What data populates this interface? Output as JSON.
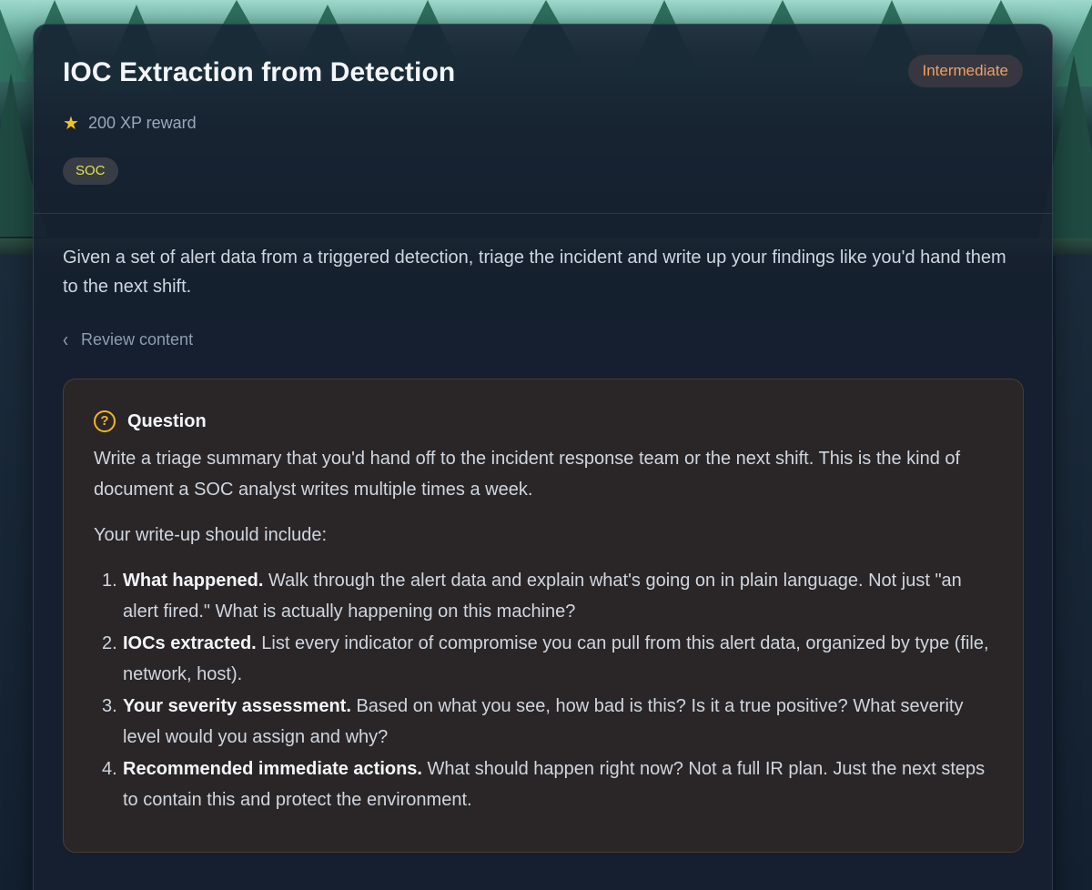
{
  "page": {
    "title": "IOC Extraction from Detection",
    "difficulty": "Intermediate",
    "reward": "200 XP reward",
    "tag": "SOC",
    "description": "Given a set of alert data from a triggered detection, triage the incident and write up your findings like you'd hand them to the next shift.",
    "review_link": "Review content"
  },
  "question": {
    "label": "Question",
    "text": "Write a triage summary that you'd hand off to the incident response team or the next shift. This is the kind of document a SOC analyst writes multiple times a week.",
    "intro": "Your write-up should include:",
    "items": [
      {
        "num": "1.",
        "title": "What happened.",
        "body": " Walk through the alert data and explain what's going on in plain language. Not just \"an alert fired.\" What is actually happening on this machine?"
      },
      {
        "num": "2.",
        "title": "IOCs extracted.",
        "body": " List every indicator of compromise you can pull from this alert data, organized by type (file, network, host)."
      },
      {
        "num": "3.",
        "title": "Your severity assessment.",
        "body": " Based on what you see, how bad is this? Is it a true positive? What severity level would you assign and why?"
      },
      {
        "num": "4.",
        "title": "Recommended immediate actions.",
        "body": " What should happen right now? Not a full IR plan. Just the next steps to contain this and protect the environment."
      }
    ]
  },
  "icons": {
    "reward": "star-icon",
    "question": "question-circle-icon",
    "back": "chevron-left-icon"
  },
  "colors": {
    "difficulty": "#f0a060",
    "tag": "#e2e14a",
    "star": "#f6c21c",
    "question_accent": "#f5b42a",
    "question_bg": "#2a2627"
  }
}
